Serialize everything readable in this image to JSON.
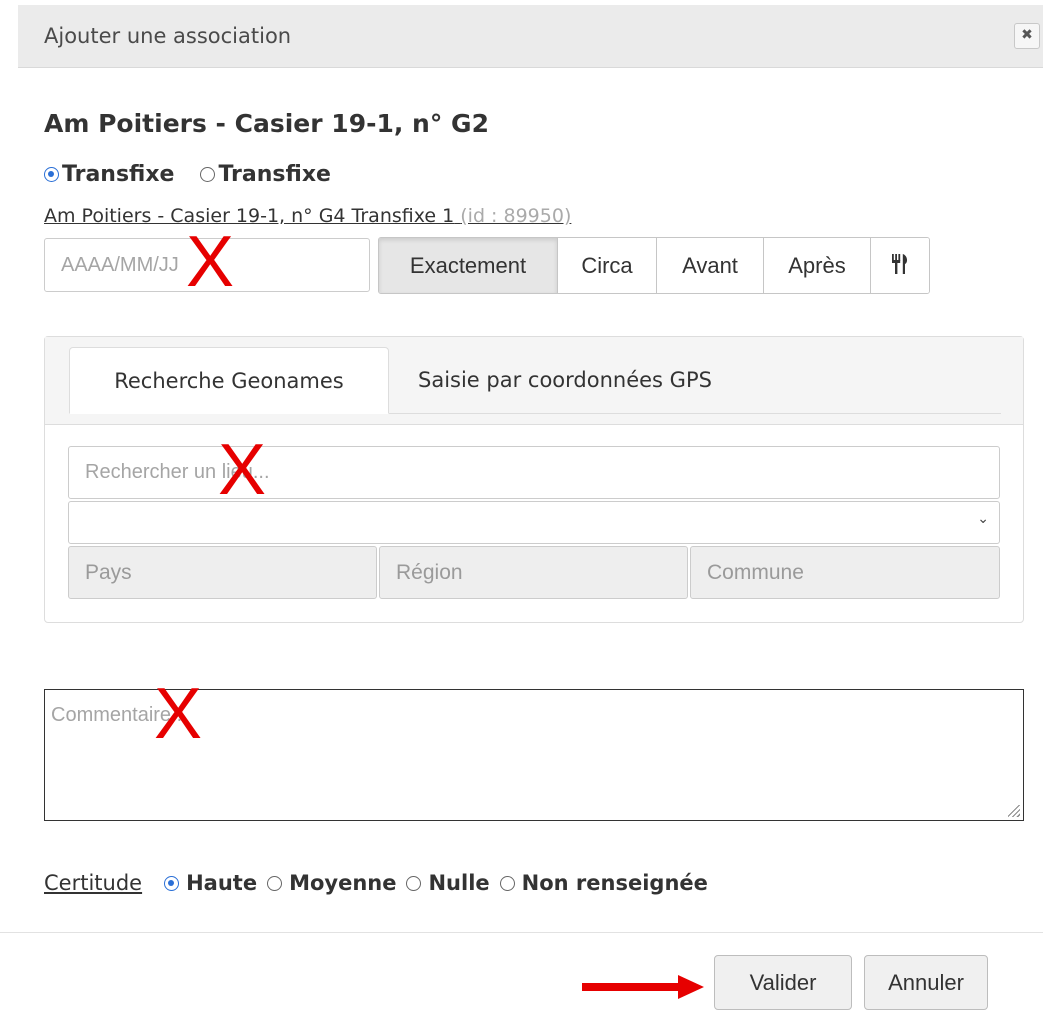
{
  "dialog": {
    "title": "Ajouter une association",
    "close_label": "✖"
  },
  "heading": "Am Poitiers - Casier 19-1, n° G2",
  "type_options": [
    {
      "label": "Transfixe",
      "selected": true
    },
    {
      "label": "Transfixe",
      "selected": false
    }
  ],
  "target_link": {
    "text": "Am Poitiers - Casier 19-1, n° G4 Transfixe 1",
    "id_text": "(id : 89950)"
  },
  "date": {
    "placeholder": "AAAA/MM/JJ",
    "modes": [
      {
        "label": "Exactement",
        "active": true
      },
      {
        "label": "Circa",
        "active": false
      },
      {
        "label": "Avant",
        "active": false
      },
      {
        "label": "Après",
        "active": false
      }
    ],
    "extra_icon": "fork-knife-icon",
    "extra_glyph": "🍴"
  },
  "place": {
    "tabs": [
      {
        "label": "Recherche Geonames",
        "active": true
      },
      {
        "label": "Saisie par coordonnées GPS",
        "active": false
      }
    ],
    "search_placeholder": "Rechercher un lieu...",
    "select_value": "",
    "fields": {
      "country": "Pays",
      "region": "Région",
      "commune": "Commune"
    }
  },
  "comment_placeholder": "Commentaire...",
  "certitude": {
    "label": "Certitude",
    "options": [
      {
        "label": "Haute",
        "selected": true
      },
      {
        "label": "Moyenne",
        "selected": false
      },
      {
        "label": "Nulle",
        "selected": false
      },
      {
        "label": "Non renseignée",
        "selected": false
      }
    ]
  },
  "footer": {
    "validate_label": "Valider",
    "cancel_label": "Annuler"
  },
  "annotations": {
    "cross_mark": "X",
    "accent_color": "#e60000"
  }
}
